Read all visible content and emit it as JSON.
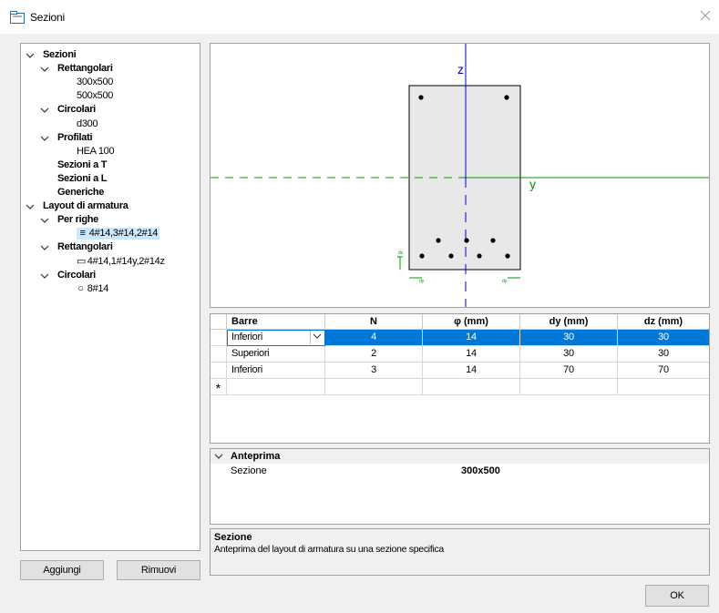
{
  "window": {
    "title": "Sezioni"
  },
  "tree": [
    {
      "label": "Sezioni",
      "bold": true,
      "expanded": true,
      "level": 0
    },
    {
      "label": "Rettangolari",
      "bold": true,
      "expanded": true,
      "level": 1
    },
    {
      "label": "300x500",
      "level": 2
    },
    {
      "label": "500x500",
      "level": 2
    },
    {
      "label": "Circolari",
      "bold": true,
      "expanded": true,
      "level": 1
    },
    {
      "label": "d300",
      "level": 2
    },
    {
      "label": "Profilati",
      "bold": true,
      "expanded": true,
      "level": 1
    },
    {
      "label": "HEA 100",
      "level": 2
    },
    {
      "label": "Sezioni a T",
      "bold": true,
      "level": 1
    },
    {
      "label": "Sezioni a L",
      "bold": true,
      "level": 1
    },
    {
      "label": "Generiche",
      "bold": true,
      "level": 1
    },
    {
      "label": "Layout di armatura",
      "bold": true,
      "expanded": true,
      "level": 0
    },
    {
      "label": "Per righe",
      "bold": true,
      "expanded": true,
      "level": 1
    },
    {
      "label": "4#14,3#14,2#14",
      "glyph": "≡",
      "level": 2,
      "selected": true
    },
    {
      "label": "Rettangolari",
      "bold": true,
      "expanded": true,
      "level": 1
    },
    {
      "label": "4#14,1#14y,2#14z",
      "glyph": "▭",
      "level": 2
    },
    {
      "label": "Circolari",
      "bold": true,
      "expanded": true,
      "level": 1
    },
    {
      "label": "8#14",
      "glyph": "○",
      "level": 2
    }
  ],
  "buttons": {
    "add": "Aggiungi",
    "remove": "Rimuovi",
    "ok": "OK"
  },
  "preview": {
    "z_axis": "z",
    "y_axis": "y",
    "dy_label": "dy",
    "dz_label": "dz",
    "colors": {
      "axis_z": "#0000cc",
      "axis_y": "#009900",
      "section_fill": "#e8e8e8",
      "bar": "#000000"
    }
  },
  "grid": {
    "columns": [
      "Barre",
      "N",
      "φ (mm)",
      "dy (mm)",
      "dz (mm)"
    ],
    "rows": [
      [
        "Inferiori",
        "4",
        "14",
        "30",
        "30"
      ],
      [
        "Superiori",
        "2",
        "14",
        "30",
        "30"
      ],
      [
        "Inferiori",
        "3",
        "14",
        "70",
        "70"
      ]
    ],
    "new_row_marker": "*",
    "selection_color": "#0078d7"
  },
  "properties": {
    "category": "Anteprima",
    "rows": [
      {
        "name": "Sezione",
        "value": "300x500"
      }
    ]
  },
  "description": {
    "title": "Sezione",
    "text": "Anteprima del layout di armatura su una sezione specifica"
  }
}
